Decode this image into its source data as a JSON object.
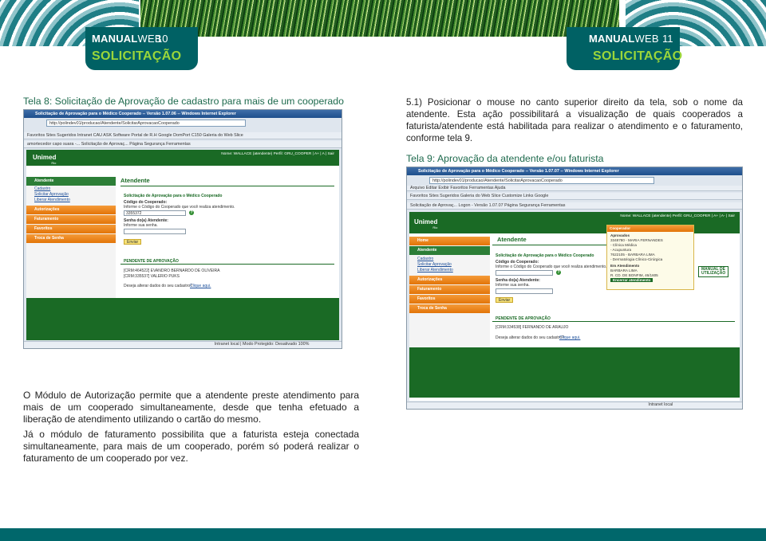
{
  "left_header": {
    "brand_bold": "MANUAL",
    "brand_light": "WEB",
    "page_number": "10",
    "section": "SOLICITAÇÃO"
  },
  "right_header": {
    "brand_bold": "MANUAL",
    "brand_light": "WEB",
    "page_number": "11",
    "section": "SOLICITAÇÃO"
  },
  "left_caption": "Tela 8: Solicitação de Aprovação de cadastro para mais de um cooperado",
  "right_step": "5.1) Posicionar o mouse no canto superior direito da tela, sob o nome da atendente. Esta ação possibilitará a visualização de quais cooperados a faturista/atendente está habilitada para realizar o atendimento e o faturamento, conforme tela 9.",
  "right_caption": "Tela 9: Aprovação da atendente e/ou faturista",
  "paragraphs": [
    "O Módulo de Autorização permite que a atendente preste atendimento para mais de um cooperado simultaneamente, desde que tenha efetuado a liberação de atendimento utilizando o cartão do mesmo.",
    "Já o módulo de faturamento possibilita que a faturista esteja conectada simultaneamente, para mais de um cooperado, porém só poderá realizar o faturamento de um cooperado por vez."
  ],
  "screen8": {
    "window_title": "Solicitação de Aprovação para o Médico Cooperado -- Versão 1.07.06 -- Windows Internet Explorer",
    "address": "http://polindev01/producao/Atendente/SolicitarAprovacaoCooperado",
    "favorites_bar": "Favoritos   Sites Sugeridos   Intranet CAU   ASK Software   Portal de R.H   Google   DomPort C150   Galeria do Web Slice",
    "tabs_bar": "amortecedor capo suara -...   Solicitação de Aprovaç...   Página   Segurança   Ferramentas",
    "logo": "Unimed",
    "logo_sub": "Rio",
    "user_line": "Nome: WALLACE (atendente)  Perfil: GRU_COOPER   | A+ | A | Sair",
    "menu": {
      "atendente": "Atendente",
      "sub": [
        "Cadastro",
        "Solicitar Aprovação",
        "Liberar Atendimento"
      ],
      "autorizacoes": "Autorizações",
      "faturamento": "Faturamento",
      "favoritos": "Favoritos",
      "troca_senha": "Troca de Senha"
    },
    "content_title": "Atendente",
    "form_title": "Solicitação de Aprovação para o Médico Cooperado",
    "code_label": "Código do Cooperado:",
    "code_hint": "Informe o Código do Cooperado que você realiza atendimento.",
    "code_value": "3355372",
    "pw_label": "Senha do(a) Atendente:",
    "pw_hint": "Informe sua senha.",
    "send_button": "Enviar",
    "pending_title": "PENDENTE DE APROVAÇÃO",
    "pending_items": [
      "[CRM:464522]  EVANDRO BERNARDO DE OLIVEIRA",
      "[CRM:335537]  VALERIO PUKS"
    ],
    "change_text": "Deseja alterar dados do seu cadastro?",
    "change_link": "Clique aqui.",
    "status": "Intranet local | Modo Protegido: Desativado      100%"
  },
  "screen9": {
    "window_title": "Solicitação de Aprovação para o Médico Cooperado -- Versão 1.07.07 -- Windows Internet Explorer",
    "address": "http://polindev01/producao/Atendente/SolicitarAprovacaoCooperado",
    "menu_bar": "Arquivo  Editar  Exibir  Favoritos  Ferramentas  Ajuda",
    "favorites_bar": "Favoritos   Sites Sugeridos   Galeria do Web Slice   Customize Links   Google",
    "tabs_bar": "Solicitação de Aprovaç...   Logon - Versão 1.07.07   Página   Segurança   Ferramentas",
    "logo": "Unimed",
    "logo_sub": "Rio",
    "user_line": "Nome: WALLACE (atendente)  Perfil: GRU_COOPER   | A+ | A- | Sair",
    "menu": {
      "home": "Home",
      "atendente": "Atendente",
      "sub": [
        "Cadastro",
        "Solicitar Aprovação",
        "Liberar Atendimento"
      ],
      "autorizacoes": "Autorizações",
      "faturamento": "Faturamento",
      "favoritos": "Favoritos",
      "troca_senha": "Troca de Senha"
    },
    "content_title": "Atendente",
    "form_title": "Solicitação de Aprovação para o Médico Cooperado",
    "code_label": "Código do Cooperado:",
    "code_hint": "Informe o Código do Cooperado que você realiza atendimento.",
    "pw_label": "Senha do(a) Atendente:",
    "pw_hint": "Informe sua senha.",
    "send_button": "Enviar",
    "pending_title": "PENDENTE DE APROVAÇÃO",
    "pending_items": [
      "[CRM:334538]  FERNANDO DE ARAUJO"
    ],
    "change_text": "Deseja alterar dados do seu cadastro?",
    "change_link": "Clique aqui.",
    "popup": {
      "title": "Cooperador",
      "approved_label": "Aprovados",
      "lines": [
        "3348780 - MARIA FERNANDES",
        "- Clínica Médica",
        "- Acupuntura",
        "7622105 - BARBARA LIMA",
        "- Dermatologia Clínico-Cirúrgica"
      ],
      "attending_label": "Em Atendimento",
      "attending_lines": [
        "BARBARA LIMA",
        "R. CD. DE BONFIM, 46/1605"
      ],
      "end_button": "Encerrar atendimento"
    },
    "badge": "MANUAL DE UTILIZAÇÃO",
    "status": "Intranet local"
  }
}
